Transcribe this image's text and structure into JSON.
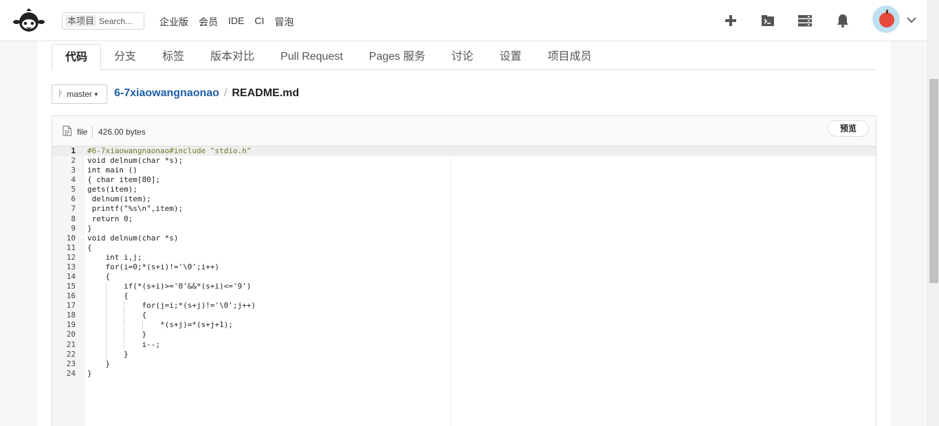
{
  "header": {
    "search": {
      "scope": "本项目",
      "placeholder": "Search..."
    },
    "nav": [
      "企业版",
      "会员",
      "IDE",
      "CI",
      "冒泡"
    ],
    "icons": [
      "plus-icon",
      "terminal-icon",
      "server-icon",
      "bell-icon",
      "avatar",
      "chevron-down-icon"
    ]
  },
  "tabs": [
    {
      "label": "代码",
      "active": true
    },
    {
      "label": "分支",
      "active": false
    },
    {
      "label": "标签",
      "active": false
    },
    {
      "label": "版本对比",
      "active": false
    },
    {
      "label": "Pull Request",
      "active": false
    },
    {
      "label": "Pages 服务",
      "active": false
    },
    {
      "label": "讨论",
      "active": false
    },
    {
      "label": "设置",
      "active": false
    },
    {
      "label": "项目成员",
      "active": false
    }
  ],
  "breadcrumb": {
    "branch": "master",
    "repo": "6-7xiaowangnaonao",
    "separator": "/",
    "file": "README.md"
  },
  "file": {
    "type": "file",
    "size": "426.00 bytes",
    "preview_label": "预览"
  },
  "code": {
    "lines": [
      "#6-7xiaowangnaonao#include \"stdio.h\"",
      "void delnum(char *s);",
      "int main ()",
      "{ char item[80];",
      "gets(item);",
      " delnum(item);",
      " printf(\"%s\\n\",item);",
      " return 0;",
      "}",
      "void delnum(char *s)",
      "{",
      "    int i,j;",
      "    for(i=0;*(s+i)!='\\0';i++)",
      "    {",
      "        if(*(s+i)>='0'&&*(s+i)<='9')",
      "        {",
      "            for(j=i;*(s+j)!='\\0';j++)",
      "            {",
      "                *(s+j)=*(s+j+1);",
      "            }",
      "            i--;",
      "        }",
      "    }",
      "}"
    ]
  },
  "colors": {
    "link": "#1f5ea8",
    "comment": "#6a7f2a",
    "avatar_bg": "#bfe0f0",
    "avatar_apple": "#e64a3b"
  }
}
